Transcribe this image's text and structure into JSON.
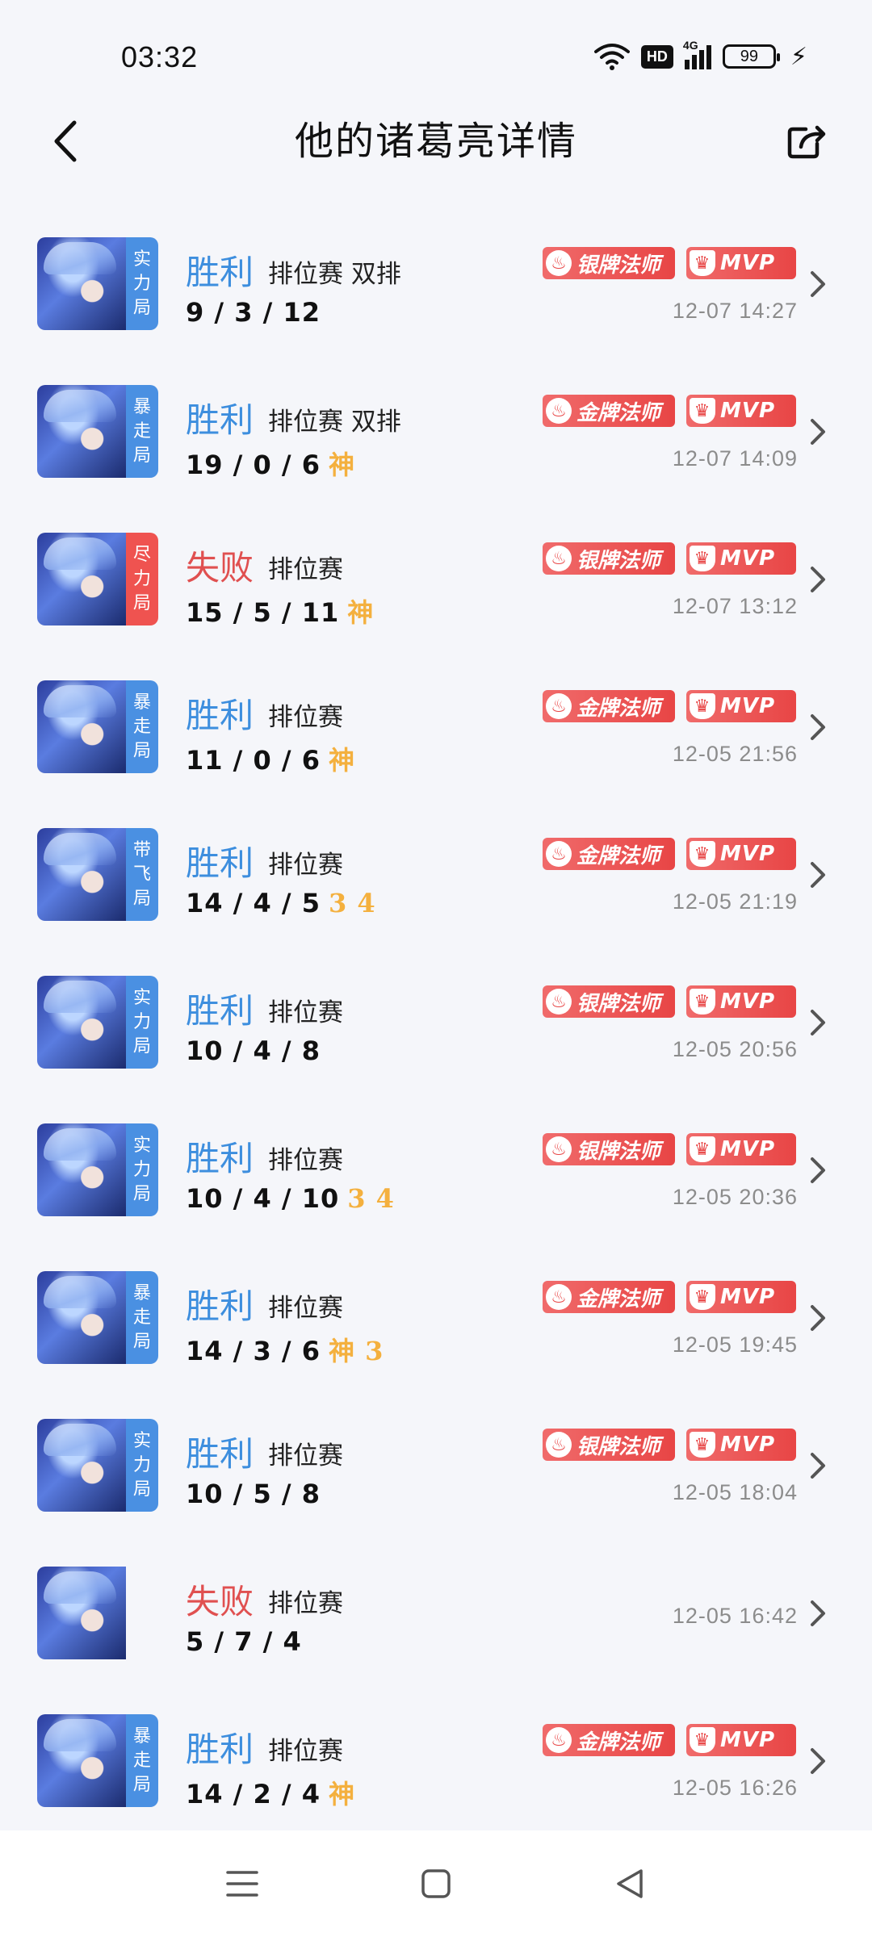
{
  "status": {
    "time": "03:32",
    "hd": "HD",
    "network": "4G",
    "battery": "99"
  },
  "header": {
    "title": "他的诸葛亮详情"
  },
  "matches": [
    {
      "tag": [
        "实",
        "力",
        "局"
      ],
      "tag_color": "blue",
      "result": "胜利",
      "result_type": "win",
      "mode": "排位赛 双排",
      "kda": "9 / 3 / 12",
      "extra": "",
      "level": "银牌法师",
      "mvp": "MVP",
      "time": "12-07 14:27"
    },
    {
      "tag": [
        "暴",
        "走",
        "局"
      ],
      "tag_color": "blue",
      "result": "胜利",
      "result_type": "win",
      "mode": "排位赛 双排",
      "kda": "19 / 0 / 6",
      "extra": "神",
      "level": "金牌法师",
      "mvp": "MVP",
      "time": "12-07 14:09"
    },
    {
      "tag": [
        "尽",
        "力",
        "局"
      ],
      "tag_color": "red",
      "result": "失败",
      "result_type": "lose",
      "mode": "排位赛",
      "kda": "15 / 5 / 11",
      "extra": "神",
      "level": "银牌法师",
      "mvp": "MVP",
      "time": "12-07 13:12"
    },
    {
      "tag": [
        "暴",
        "走",
        "局"
      ],
      "tag_color": "blue",
      "result": "胜利",
      "result_type": "win",
      "mode": "排位赛",
      "kda": "11 / 0 / 6",
      "extra": "神",
      "level": "金牌法师",
      "mvp": "MVP",
      "time": "12-05 21:56"
    },
    {
      "tag": [
        "带",
        "飞",
        "局"
      ],
      "tag_color": "blue",
      "result": "胜利",
      "result_type": "win",
      "mode": "排位赛",
      "kda": "14 / 4 / 5",
      "extra": "3 4",
      "level": "金牌法师",
      "mvp": "MVP",
      "time": "12-05 21:19"
    },
    {
      "tag": [
        "实",
        "力",
        "局"
      ],
      "tag_color": "blue",
      "result": "胜利",
      "result_type": "win",
      "mode": "排位赛",
      "kda": "10 / 4 / 8",
      "extra": "",
      "level": "银牌法师",
      "mvp": "MVP",
      "time": "12-05 20:56"
    },
    {
      "tag": [
        "实",
        "力",
        "局"
      ],
      "tag_color": "blue",
      "result": "胜利",
      "result_type": "win",
      "mode": "排位赛",
      "kda": "10 / 4 / 10",
      "extra": "3 4",
      "level": "银牌法师",
      "mvp": "MVP",
      "time": "12-05 20:36"
    },
    {
      "tag": [
        "暴",
        "走",
        "局"
      ],
      "tag_color": "blue",
      "result": "胜利",
      "result_type": "win",
      "mode": "排位赛",
      "kda": "14 / 3 / 6",
      "extra": "神 3",
      "level": "金牌法师",
      "mvp": "MVP",
      "time": "12-05 19:45"
    },
    {
      "tag": [
        "实",
        "力",
        "局"
      ],
      "tag_color": "blue",
      "result": "胜利",
      "result_type": "win",
      "mode": "排位赛",
      "kda": "10 / 5 / 8",
      "extra": "",
      "level": "银牌法师",
      "mvp": "MVP",
      "time": "12-05 18:04"
    },
    {
      "tag": [],
      "tag_color": "none",
      "result": "失败",
      "result_type": "lose",
      "mode": "排位赛",
      "kda": "5 / 7 / 4",
      "extra": "",
      "level": "",
      "mvp": "",
      "time": "12-05 16:42"
    },
    {
      "tag": [
        "暴",
        "走",
        "局"
      ],
      "tag_color": "blue",
      "result": "胜利",
      "result_type": "win",
      "mode": "排位赛",
      "kda": "14 / 2 / 4",
      "extra": "神",
      "level": "金牌法师",
      "mvp": "MVP",
      "time": "12-05 16:26"
    }
  ],
  "icons": {
    "back": "chevron-left-icon",
    "share": "share-icon",
    "chevron": "chevron-right-icon",
    "nav": [
      "menu-icon",
      "home-square-icon",
      "back-triangle-icon"
    ]
  },
  "colors": {
    "win": "#3d8ede",
    "lose": "#e05050",
    "badge": "#e84545",
    "extra": "#f4b03e",
    "tag_blue": "#4a90e2",
    "tag_red": "#ef5350"
  }
}
